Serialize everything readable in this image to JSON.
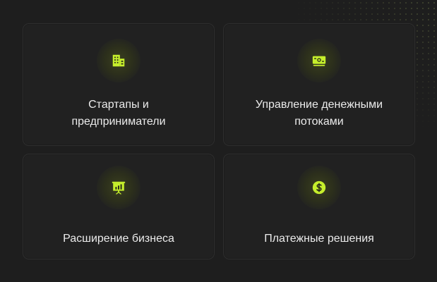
{
  "colors": {
    "background": "#1e1e1e",
    "card": "#212121",
    "accent": "#c6ef2c"
  },
  "cards": [
    {
      "icon": "building-icon",
      "label": "Стартапы и предприниматели"
    },
    {
      "icon": "cash-icon",
      "label": "Управление денежными потоками"
    },
    {
      "icon": "presentation-chart-icon",
      "label": "Расширение бизнеса"
    },
    {
      "icon": "dollar-coin-icon",
      "label": "Платежные решения"
    }
  ]
}
